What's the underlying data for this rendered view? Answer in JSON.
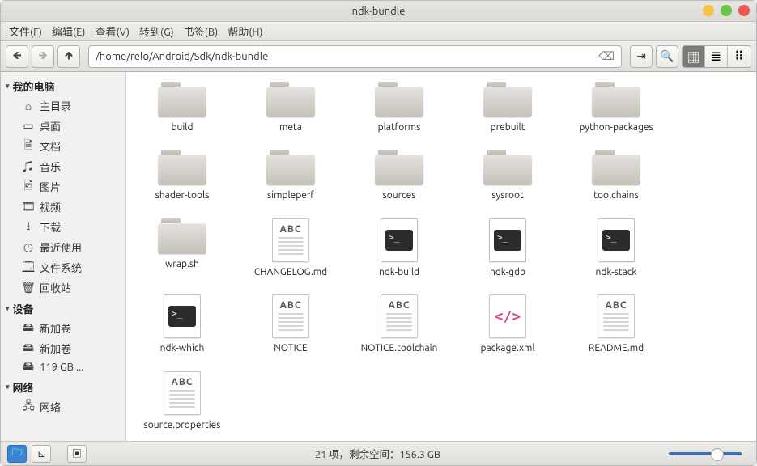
{
  "window": {
    "title": "ndk-bundle"
  },
  "menubar": [
    "文件(F)",
    "编辑(E)",
    "查看(V)",
    "转到(G)",
    "书签(B)",
    "帮助(H)"
  ],
  "toolbar": {
    "path": "/home/relo/Android/Sdk/ndk-bundle"
  },
  "sidebar": {
    "sections": [
      {
        "title": "我的电脑",
        "items": [
          {
            "icon": "home-icon",
            "label": "主目录"
          },
          {
            "icon": "desktop-icon",
            "label": "桌面"
          },
          {
            "icon": "document-icon",
            "label": "文档"
          },
          {
            "icon": "music-icon",
            "label": "音乐"
          },
          {
            "icon": "picture-icon",
            "label": "图片"
          },
          {
            "icon": "video-icon",
            "label": "视频"
          },
          {
            "icon": "download-icon",
            "label": "下载"
          },
          {
            "icon": "recent-icon",
            "label": "最近使用"
          },
          {
            "icon": "filesystem-icon",
            "label": "文件系统",
            "active": true
          },
          {
            "icon": "trash-icon",
            "label": "回收站"
          }
        ]
      },
      {
        "title": "设备",
        "items": [
          {
            "icon": "disk-icon",
            "label": "新加卷"
          },
          {
            "icon": "disk-icon",
            "label": "新加卷"
          },
          {
            "icon": "disk-icon",
            "label": "119 GB ..."
          }
        ]
      },
      {
        "title": "网络",
        "items": [
          {
            "icon": "network-icon",
            "label": "网络"
          }
        ]
      }
    ]
  },
  "items": [
    {
      "kind": "folder",
      "name": "build"
    },
    {
      "kind": "folder",
      "name": "meta"
    },
    {
      "kind": "folder",
      "name": "platforms"
    },
    {
      "kind": "folder",
      "name": "prebuilt"
    },
    {
      "kind": "folder",
      "name": "python-packages"
    },
    {
      "kind": "folder",
      "name": "shader-tools"
    },
    {
      "kind": "folder",
      "name": "simpleperf"
    },
    {
      "kind": "folder",
      "name": "sources"
    },
    {
      "kind": "folder",
      "name": "sysroot"
    },
    {
      "kind": "folder",
      "name": "toolchains"
    },
    {
      "kind": "folder",
      "name": "wrap.sh"
    },
    {
      "kind": "text",
      "name": "CHANGELOG.md"
    },
    {
      "kind": "script",
      "name": "ndk-build"
    },
    {
      "kind": "script",
      "name": "ndk-gdb"
    },
    {
      "kind": "script",
      "name": "ndk-stack"
    },
    {
      "kind": "script",
      "name": "ndk-which"
    },
    {
      "kind": "text",
      "name": "NOTICE"
    },
    {
      "kind": "text",
      "name": "NOTICE.toolchain"
    },
    {
      "kind": "xml",
      "name": "package.xml"
    },
    {
      "kind": "text",
      "name": "README.md"
    },
    {
      "kind": "text",
      "name": "source.properties"
    }
  ],
  "status": {
    "count_label": "21 项",
    "sep": "，",
    "space_label": "剩余空间：",
    "space_value": "156.3 GB"
  },
  "glyphs": {
    "home-icon": "⌂",
    "desktop-icon": "▭",
    "document-icon": "🗎",
    "music-icon": "♫",
    "picture-icon": "🖻",
    "video-icon": "🎞",
    "download-icon": "⭳",
    "recent-icon": "◷",
    "filesystem-icon": "🗔",
    "trash-icon": "🗑",
    "disk-icon": "🖴",
    "network-icon": "🖧"
  }
}
